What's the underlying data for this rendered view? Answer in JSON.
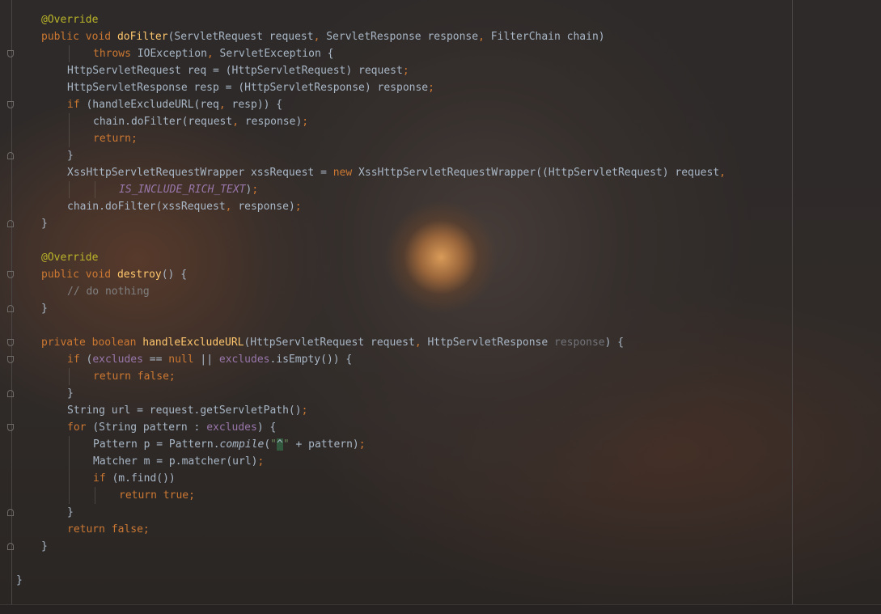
{
  "editor": {
    "colors": {
      "keyword": "#cc7832",
      "annotation": "#bbb529",
      "method": "#ffc66d",
      "field": "#9876aa",
      "string": "#6a8759",
      "comment": "#808080",
      "plain": "#a9b7c6"
    },
    "lines": [
      {
        "indent": 0,
        "fold": "",
        "tokens": [
          {
            "t": "@Override",
            "c": "ann"
          }
        ]
      },
      {
        "indent": 0,
        "fold": "",
        "tokens": [
          {
            "t": "public ",
            "c": "kw"
          },
          {
            "t": "void ",
            "c": "kw"
          },
          {
            "t": "doFilter",
            "c": "fn"
          },
          {
            "t": "(ServletRequest request",
            "c": ""
          },
          {
            "t": ", ",
            "c": "kw"
          },
          {
            "t": "ServletResponse response",
            "c": ""
          },
          {
            "t": ", ",
            "c": "kw"
          },
          {
            "t": "FilterChain chain)",
            "c": ""
          }
        ]
      },
      {
        "indent": 2,
        "fold": "start",
        "tokens": [
          {
            "t": "throws ",
            "c": "kw"
          },
          {
            "t": "IOException",
            "c": ""
          },
          {
            "t": ", ",
            "c": "kw"
          },
          {
            "t": "ServletException {",
            "c": ""
          }
        ]
      },
      {
        "indent": 1,
        "fold": "",
        "tokens": [
          {
            "t": "HttpServletRequest req = (HttpServletRequest) request",
            "c": ""
          },
          {
            "t": ";",
            "c": "kw"
          }
        ]
      },
      {
        "indent": 1,
        "fold": "",
        "tokens": [
          {
            "t": "HttpServletResponse resp = (HttpServletResponse) response",
            "c": ""
          },
          {
            "t": ";",
            "c": "kw"
          }
        ]
      },
      {
        "indent": 1,
        "fold": "start",
        "tokens": [
          {
            "t": "if ",
            "c": "kw"
          },
          {
            "t": "(handleExcludeURL(req",
            "c": ""
          },
          {
            "t": ", ",
            "c": "kw"
          },
          {
            "t": "resp)) {",
            "c": ""
          }
        ]
      },
      {
        "indent": 2,
        "fold": "",
        "tokens": [
          {
            "t": "chain.doFilter(request",
            "c": ""
          },
          {
            "t": ", ",
            "c": "kw"
          },
          {
            "t": "response)",
            "c": ""
          },
          {
            "t": ";",
            "c": "kw"
          }
        ]
      },
      {
        "indent": 2,
        "fold": "",
        "tokens": [
          {
            "t": "return;",
            "c": "kw"
          }
        ]
      },
      {
        "indent": 1,
        "fold": "end",
        "tokens": [
          {
            "t": "}",
            "c": ""
          }
        ]
      },
      {
        "indent": 1,
        "fold": "",
        "tokens": [
          {
            "t": "XssHttpServletRequestWrapper xssRequest = ",
            "c": ""
          },
          {
            "t": "new ",
            "c": "kw"
          },
          {
            "t": "XssHttpServletRequestWrapper((HttpServletRequest) request",
            "c": ""
          },
          {
            "t": ",",
            "c": "kw"
          }
        ]
      },
      {
        "indent": 3,
        "fold": "",
        "tokens": [
          {
            "t": "IS_INCLUDE_RICH_TEXT",
            "c": "const"
          },
          {
            "t": ")",
            "c": ""
          },
          {
            "t": ";",
            "c": "kw"
          }
        ]
      },
      {
        "indent": 1,
        "fold": "",
        "tokens": [
          {
            "t": "chain.doFilter(xssRequest",
            "c": ""
          },
          {
            "t": ", ",
            "c": "kw"
          },
          {
            "t": "response)",
            "c": ""
          },
          {
            "t": ";",
            "c": "kw"
          }
        ]
      },
      {
        "indent": 0,
        "fold": "end",
        "tokens": [
          {
            "t": "}",
            "c": ""
          }
        ]
      },
      {
        "indent": 0,
        "fold": "",
        "tokens": []
      },
      {
        "indent": 0,
        "fold": "",
        "tokens": [
          {
            "t": "@Override",
            "c": "ann"
          }
        ]
      },
      {
        "indent": 0,
        "fold": "start",
        "tokens": [
          {
            "t": "public ",
            "c": "kw"
          },
          {
            "t": "void ",
            "c": "kw"
          },
          {
            "t": "destroy",
            "c": "fn"
          },
          {
            "t": "() {",
            "c": ""
          }
        ]
      },
      {
        "indent": 1,
        "fold": "",
        "tokens": [
          {
            "t": "// do nothing",
            "c": "cmt"
          }
        ]
      },
      {
        "indent": 0,
        "fold": "end",
        "tokens": [
          {
            "t": "}",
            "c": ""
          }
        ]
      },
      {
        "indent": 0,
        "fold": "",
        "tokens": []
      },
      {
        "indent": 0,
        "fold": "start",
        "tokens": [
          {
            "t": "private ",
            "c": "kw"
          },
          {
            "t": "boolean ",
            "c": "kw"
          },
          {
            "t": "handleExcludeURL",
            "c": "fn"
          },
          {
            "t": "(HttpServletRequest request",
            "c": ""
          },
          {
            "t": ", ",
            "c": "kw"
          },
          {
            "t": "HttpServletResponse ",
            "c": ""
          },
          {
            "t": "response",
            "c": "unused"
          },
          {
            "t": ") {",
            "c": ""
          }
        ]
      },
      {
        "indent": 1,
        "fold": "start",
        "tokens": [
          {
            "t": "if ",
            "c": "kw"
          },
          {
            "t": "(",
            "c": ""
          },
          {
            "t": "excludes",
            "c": "fld"
          },
          {
            "t": " == ",
            "c": ""
          },
          {
            "t": "null ",
            "c": "kw"
          },
          {
            "t": "|| ",
            "c": ""
          },
          {
            "t": "excludes",
            "c": "fld"
          },
          {
            "t": ".isEmpty()) {",
            "c": ""
          }
        ]
      },
      {
        "indent": 2,
        "fold": "",
        "tokens": [
          {
            "t": "return false;",
            "c": "kw"
          }
        ]
      },
      {
        "indent": 1,
        "fold": "end",
        "tokens": [
          {
            "t": "}",
            "c": ""
          }
        ]
      },
      {
        "indent": 1,
        "fold": "",
        "tokens": [
          {
            "t": "String url = request.getServletPath()",
            "c": ""
          },
          {
            "t": ";",
            "c": "kw"
          }
        ]
      },
      {
        "indent": 1,
        "fold": "start",
        "tokens": [
          {
            "t": "for ",
            "c": "kw"
          },
          {
            "t": "(String pattern : ",
            "c": ""
          },
          {
            "t": "excludes",
            "c": "fld"
          },
          {
            "t": ") {",
            "c": ""
          }
        ]
      },
      {
        "indent": 2,
        "fold": "",
        "tokens": [
          {
            "t": "Pattern p = Pattern.",
            "c": ""
          },
          {
            "t": "compile",
            "c": "itl"
          },
          {
            "t": "(",
            "c": ""
          },
          {
            "t": "\"",
            "c": "str"
          },
          {
            "t": "^",
            "c": "caret-hl"
          },
          {
            "t": "\" ",
            "c": "str"
          },
          {
            "t": "+ pattern)",
            "c": ""
          },
          {
            "t": ";",
            "c": "kw"
          }
        ]
      },
      {
        "indent": 2,
        "fold": "",
        "tokens": [
          {
            "t": "Matcher m = p.matcher(url)",
            "c": ""
          },
          {
            "t": ";",
            "c": "kw"
          }
        ]
      },
      {
        "indent": 2,
        "fold": "",
        "tokens": [
          {
            "t": "if ",
            "c": "kw"
          },
          {
            "t": "(m.find())",
            "c": ""
          }
        ]
      },
      {
        "indent": 3,
        "fold": "",
        "tokens": [
          {
            "t": "return true;",
            "c": "kw"
          }
        ]
      },
      {
        "indent": 1,
        "fold": "end",
        "tokens": [
          {
            "t": "}",
            "c": ""
          }
        ]
      },
      {
        "indent": 1,
        "fold": "",
        "tokens": [
          {
            "t": "return false;",
            "c": "kw"
          }
        ]
      },
      {
        "indent": 0,
        "fold": "end",
        "tokens": [
          {
            "t": "}",
            "c": ""
          }
        ]
      },
      {
        "indent": 0,
        "fold": "",
        "tokens": []
      },
      {
        "indent": -1,
        "fold": "",
        "tokens": [
          {
            "t": "}",
            "c": ""
          }
        ]
      }
    ]
  }
}
